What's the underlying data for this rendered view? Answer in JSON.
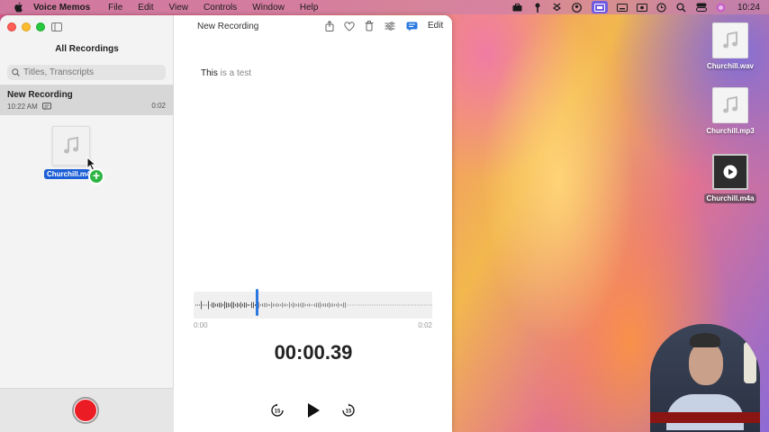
{
  "menubar": {
    "app_name": "Voice Memos",
    "items": [
      "File",
      "Edit",
      "View",
      "Controls",
      "Window",
      "Help"
    ],
    "clock": "10:24"
  },
  "sidebar": {
    "title": "All Recordings",
    "search_placeholder": "Titles, Transcripts",
    "recordings": [
      {
        "title": "New Recording",
        "time": "10:22 AM",
        "duration": "0:02"
      }
    ],
    "drag_file_label": "Churchill.m4a"
  },
  "main": {
    "title": "New Recording",
    "edit_label": "Edit",
    "transcript_highlight": "This",
    "transcript_rest": " is a test",
    "time_start": "0:00",
    "time_end": "0:02",
    "current_time": "00:00.39",
    "skip_back_label": "15",
    "skip_forward_label": "15",
    "playback_fraction": 0.26
  },
  "desktop": {
    "files": [
      {
        "label": "Churchill.wav",
        "icon": "audio-file-icon"
      },
      {
        "label": "Churchill.mp3",
        "icon": "audio-file-icon"
      },
      {
        "label": "Churchill.m4a",
        "icon": "video-file-icon"
      }
    ]
  },
  "colors": {
    "record": "#ec1c24",
    "accent": "#2a78e0",
    "selection": "#1c5fd6"
  }
}
